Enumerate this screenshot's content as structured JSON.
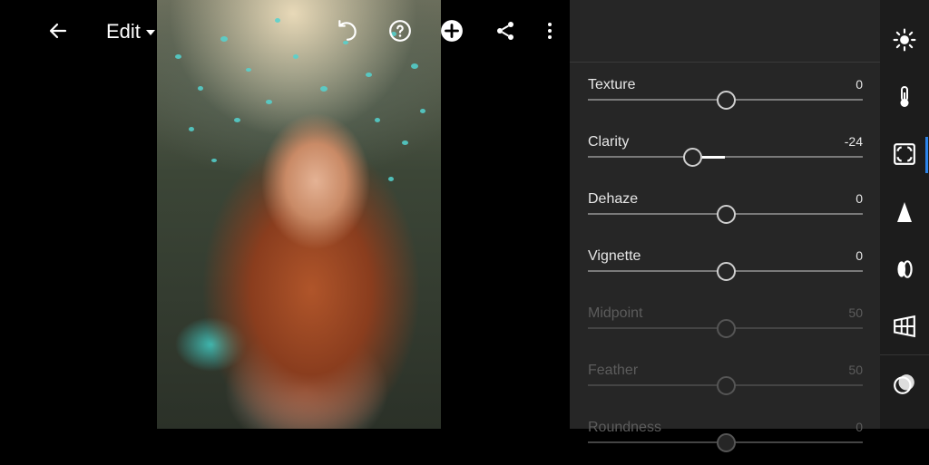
{
  "topbar": {
    "title": "Edit",
    "icons": [
      "back-arrow-icon",
      "undo-icon",
      "help-icon",
      "add-icon",
      "share-icon",
      "more-icon"
    ]
  },
  "panel": {
    "sliders": [
      {
        "label": "Texture",
        "value": "0",
        "numeric": 0,
        "enabled": true
      },
      {
        "label": "Clarity",
        "value": "-24",
        "numeric": -24,
        "enabled": true
      },
      {
        "label": "Dehaze",
        "value": "0",
        "numeric": 0,
        "enabled": true
      },
      {
        "label": "Vignette",
        "value": "0",
        "numeric": 0,
        "enabled": true
      },
      {
        "label": "Midpoint",
        "value": "50",
        "numeric": 50,
        "enabled": false
      },
      {
        "label": "Feather",
        "value": "50",
        "numeric": 50,
        "enabled": false
      },
      {
        "label": "Roundness",
        "value": "0",
        "numeric": 0,
        "enabled": false
      }
    ]
  },
  "rail": {
    "tools": [
      "light-icon",
      "color-icon",
      "effects-icon",
      "detail-icon",
      "optics-icon",
      "geometry-icon",
      "presets-icon"
    ],
    "active": "effects-icon",
    "accent": "#2e84ea"
  }
}
